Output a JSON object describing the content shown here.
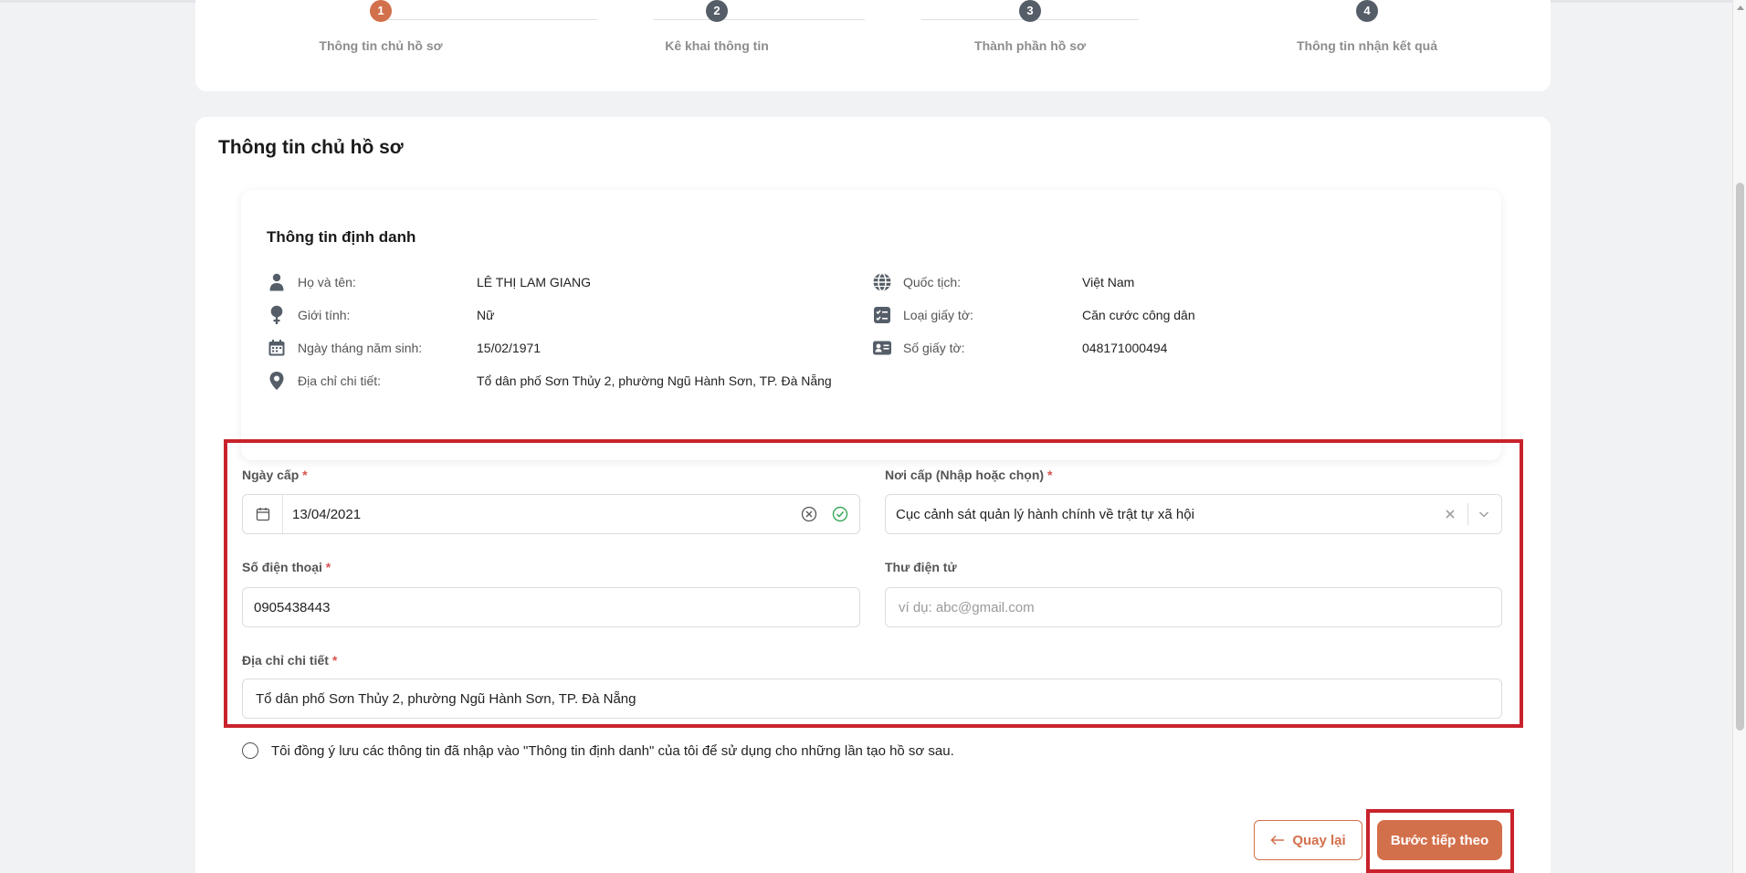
{
  "stepper": {
    "steps": [
      {
        "number": "1",
        "label": "Thông tin chủ hồ sơ",
        "active": true
      },
      {
        "number": "2",
        "label": "Kê khai thông tin",
        "active": false
      },
      {
        "number": "3",
        "label": "Thành phần hồ sơ",
        "active": false
      },
      {
        "number": "4",
        "label": "Thông tin nhận kết quả",
        "active": false
      }
    ]
  },
  "page": {
    "title": "Thông tin chủ hồ sơ"
  },
  "identity": {
    "title": "Thông tin định danh",
    "left": [
      {
        "icon": "person-icon",
        "label": "Họ và tên:",
        "value": "LÊ THỊ LAM GIANG"
      },
      {
        "icon": "gender-icon",
        "label": "Giới tính:",
        "value": "Nữ"
      },
      {
        "icon": "calendar-icon",
        "label": "Ngày tháng năm sinh:",
        "value": "15/02/1971"
      },
      {
        "icon": "location-pin-icon",
        "label": "Địa chỉ chi tiết:",
        "value": "Tổ dân phố Sơn Thủy 2, phường Ngũ Hành Sơn, TP. Đà Nẵng"
      }
    ],
    "right": [
      {
        "icon": "globe-icon",
        "label": "Quốc tịch:",
        "value": "Việt Nam"
      },
      {
        "icon": "checklist-icon",
        "label": "Loại giấy tờ:",
        "value": "Căn cước công dân"
      },
      {
        "icon": "id-card-icon",
        "label": "Số giấy tờ:",
        "value": "048171000494"
      }
    ]
  },
  "form": {
    "issue_date": {
      "label": "Ngày cấp",
      "required_mark": "*",
      "value": "13/04/2021"
    },
    "issue_place": {
      "label": "Nơi cấp (Nhập hoặc chọn)",
      "required_mark": "*",
      "value": "Cục cảnh sát quản lý hành chính về trật tự xã hội"
    },
    "phone": {
      "label": "Số điện thoại",
      "required_mark": "*",
      "value": "0905438443"
    },
    "email": {
      "label": "Thư điện tử",
      "value": "",
      "placeholder": "ví dụ: abc@gmail.com"
    },
    "address": {
      "label": "Địa chỉ chi tiết",
      "required_mark": "*",
      "value": "Tổ dân phố Sơn Thủy 2, phường Ngũ Hành Sơn, TP. Đà Nẵng"
    }
  },
  "consent": {
    "text": "Tôi đồng ý lưu các thông tin đã nhập vào \"Thông tin định danh\" của tôi để sử dụng cho những lần tạo hồ sơ sau."
  },
  "actions": {
    "back_label": "Quay lại",
    "next_label": "Bước tiếp theo"
  },
  "colors": {
    "accent": "#d3704c",
    "step_inactive": "#555e68",
    "highlight": "#c8232c",
    "success": "#3aa757"
  }
}
